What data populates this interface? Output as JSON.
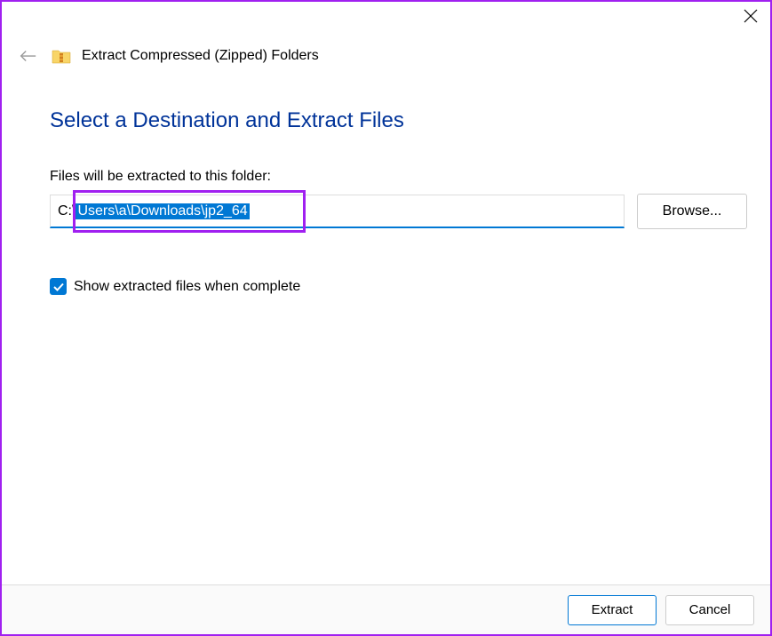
{
  "window": {
    "title": "Extract Compressed (Zipped) Folders"
  },
  "content": {
    "heading": "Select a Destination and Extract Files",
    "destination_label": "Files will be extracted to this folder:",
    "path_prefix": "C:\\",
    "path_selected": "Users\\a\\Downloads\\jp2_64",
    "browse_label": "Browse...",
    "checkbox_label": "Show extracted files when complete",
    "checkbox_checked": true
  },
  "footer": {
    "extract_label": "Extract",
    "cancel_label": "Cancel"
  },
  "annotation": {
    "highlight_color": "#a020f0"
  }
}
